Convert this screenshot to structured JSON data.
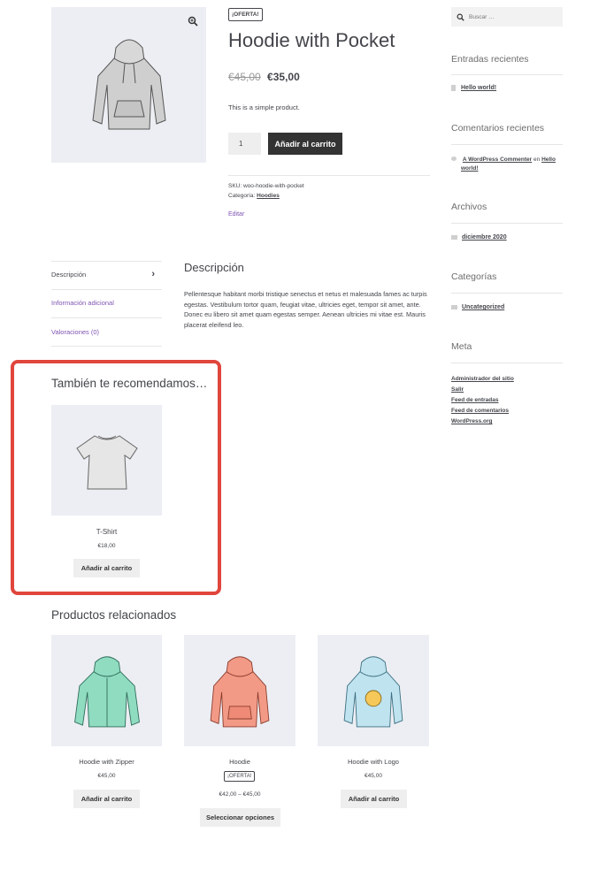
{
  "product": {
    "sale_badge": "¡OFERTA!",
    "title": "Hoodie with Pocket",
    "old_price": "€45,00",
    "price": "€35,00",
    "short_description": "This is a simple product.",
    "quantity": "1",
    "add_to_cart_label": "Añadir al carrito",
    "sku_label": "SKU:",
    "sku": "woo-hoodie-with-pocket",
    "category_label": "Categoría:",
    "category": "Hoodies",
    "edit_label": "Editar",
    "zoom_icon": "magnifier-icon"
  },
  "tabs": {
    "items": [
      {
        "label": "Descripción"
      },
      {
        "label": "Información adicional"
      },
      {
        "label": "Valoraciones (0)"
      }
    ],
    "active_chevron": "›",
    "panel_title": "Descripción",
    "panel_text": "Pellentesque habitant morbi tristique senectus et netus et malesuada fames ac turpis egestas. Vestibulum tortor quam, feugiat vitae, ultricies eget, tempor sit amet, ante. Donec eu libero sit amet quam egestas semper. Aenean ultricies mi vitae est. Mauris placerat eleifend leo."
  },
  "upsells": {
    "title": "También te recomendamos…",
    "highlight_color": "#e0463c",
    "items": [
      {
        "name": "T-Shirt",
        "price": "€18,00",
        "button": "Añadir al carrito"
      }
    ]
  },
  "related": {
    "title": "Productos relacionados",
    "items": [
      {
        "name": "Hoodie with Zipper",
        "price": "€45,00",
        "button": "Añadir al carrito"
      },
      {
        "name": "Hoodie",
        "badge": "¡OFERTA!",
        "price": "€42,00 – €45,00",
        "button": "Seleccionar opciones"
      },
      {
        "name": "Hoodie with Logo",
        "price": "€45,00",
        "button": "Añadir al carrito"
      }
    ]
  },
  "sidebar": {
    "search_placeholder": "Buscar …",
    "recent_posts_title": "Entradas recientes",
    "recent_post": "Hello world!",
    "recent_comments_title": "Comentarios recientes",
    "comment_author": "A WordPress Commenter",
    "comment_on": "en",
    "comment_post_a": "Hello",
    "comment_post_b": "world!",
    "archives_title": "Archivos",
    "archive_item": "diciembre 2020",
    "categories_title": "Categorías",
    "category_item": "Uncategorized",
    "meta_title": "Meta",
    "meta_links": [
      "Administrador del sitio",
      "Salir",
      "Feed de entradas",
      "Feed de comentarios",
      "WordPress.org"
    ]
  },
  "colors": {
    "dark_button": "#333333",
    "image_bg": "#eceef3",
    "sale_price": "#43454b",
    "accent_purple": "#7f54b3"
  }
}
